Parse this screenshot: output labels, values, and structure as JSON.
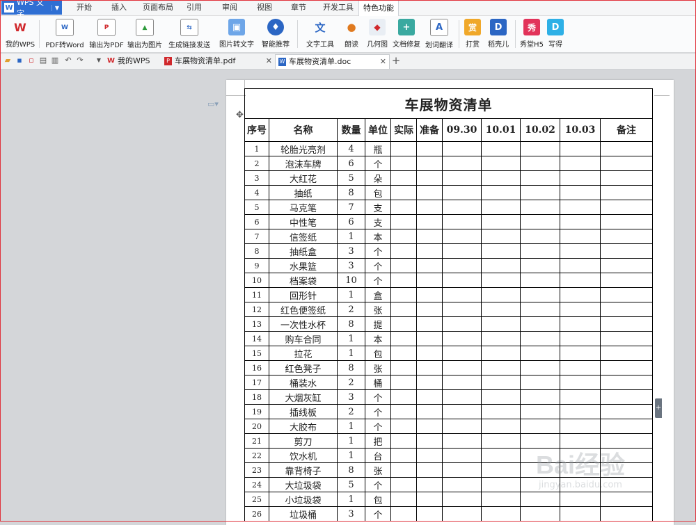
{
  "app": {
    "name": "WPS 文字"
  },
  "menu_tabs": [
    "开始",
    "插入",
    "页面布局",
    "引用",
    "审阅",
    "视图",
    "章节",
    "开发工具",
    "特色功能"
  ],
  "active_menu_tab": "特色功能",
  "ribbon": {
    "my_wps": "我的WPS",
    "pdf_to_word": "PDF转Word",
    "export_pdf": "输出为PDF",
    "export_image": "输出为图片",
    "share_link": "生成链接发送",
    "image_to_text": "图片转文字",
    "smart_recommend": "智能推荐",
    "text_tools": "文字工具",
    "read_aloud": "朗读",
    "geometry": "几何图",
    "doc_repair": "文档修复",
    "word_translate": "划词翻译",
    "reward": "打赏",
    "shell": "稻壳儿",
    "show_h5": "秀堂H5",
    "write": "写得"
  },
  "doc_tabs": [
    {
      "label": "我的WPS"
    },
    {
      "label": "车展物资清单.pdf"
    },
    {
      "label": "车展物资清单.doc"
    }
  ],
  "document": {
    "title": "车展物资清单",
    "headers": [
      "序号",
      "名称",
      "数量",
      "单位",
      "实际",
      "准备",
      "09.30",
      "10.01",
      "10.02",
      "10.03",
      "备注"
    ],
    "rows": [
      [
        "1",
        "轮胎光亮剂",
        "4",
        "瓶"
      ],
      [
        "2",
        "泡沫车牌",
        "6",
        "个"
      ],
      [
        "3",
        "大红花",
        "5",
        "朵"
      ],
      [
        "4",
        "抽纸",
        "8",
        "包"
      ],
      [
        "5",
        "马克笔",
        "7",
        "支"
      ],
      [
        "6",
        "中性笔",
        "6",
        "支"
      ],
      [
        "7",
        "信签纸",
        "1",
        "本"
      ],
      [
        "8",
        "抽纸盒",
        "3",
        "个"
      ],
      [
        "9",
        "水果篮",
        "3",
        "个"
      ],
      [
        "10",
        "档案袋",
        "10",
        "个"
      ],
      [
        "11",
        "回形针",
        "1",
        "盒"
      ],
      [
        "12",
        "红色便签纸",
        "2",
        "张"
      ],
      [
        "13",
        "一次性水杯",
        "8",
        "提"
      ],
      [
        "14",
        "购车合同",
        "1",
        "本"
      ],
      [
        "15",
        "拉花",
        "1",
        "包"
      ],
      [
        "16",
        "红色凳子",
        "8",
        "张"
      ],
      [
        "17",
        "桶装水",
        "2",
        "桶"
      ],
      [
        "18",
        "大烟灰缸",
        "3",
        "个"
      ],
      [
        "19",
        "插线板",
        "2",
        "个"
      ],
      [
        "20",
        "大胶布",
        "1",
        "个"
      ],
      [
        "21",
        "剪刀",
        "1",
        "把"
      ],
      [
        "22",
        "饮水机",
        "1",
        "台"
      ],
      [
        "23",
        "靠背椅子",
        "8",
        "张"
      ],
      [
        "24",
        "大垃圾袋",
        "5",
        "个"
      ],
      [
        "25",
        "小垃圾袋",
        "1",
        "包"
      ],
      [
        "26",
        "垃圾桶",
        "3",
        "个"
      ]
    ]
  },
  "watermark": {
    "brand": "Bai经验",
    "url": "jingyan.baidu.com"
  }
}
